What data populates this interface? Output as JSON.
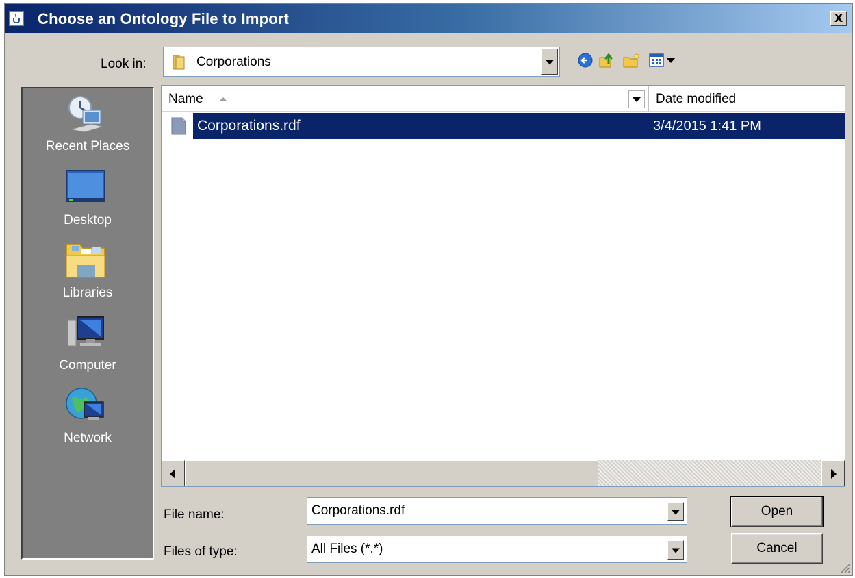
{
  "window": {
    "title": "Choose an Ontology File to Import"
  },
  "title_bar": {
    "close_label": "X"
  },
  "look_in": {
    "label": "Look in:",
    "value": "Corporations"
  },
  "toolbar": {
    "icons": [
      "back-icon",
      "up-folder-icon",
      "new-folder-icon",
      "view-menu-icon"
    ]
  },
  "places": [
    {
      "label": "Recent Places",
      "icon": "recent-places-icon"
    },
    {
      "label": "Desktop",
      "icon": "desktop-icon"
    },
    {
      "label": "Libraries",
      "icon": "libraries-icon"
    },
    {
      "label": "Computer",
      "icon": "computer-icon"
    },
    {
      "label": "Network",
      "icon": "network-icon"
    }
  ],
  "file_list": {
    "columns": [
      "Name",
      "Date modified"
    ],
    "rows": [
      {
        "name": "Corporations.rdf",
        "date_modified": "3/4/2015 1:41 PM",
        "selected": true
      }
    ]
  },
  "file_name": {
    "label": "File name:",
    "value": "Corporations.rdf"
  },
  "file_type": {
    "label": "Files of type:",
    "value": "All Files (*.*)"
  },
  "buttons": {
    "open": "Open",
    "cancel": "Cancel"
  },
  "colors": {
    "title_bar_start": "#0a246a",
    "title_bar_end": "#a6caf0",
    "selection": "#0a246a",
    "dialog_face": "#d4d0c8",
    "places_bar": "#808080"
  }
}
